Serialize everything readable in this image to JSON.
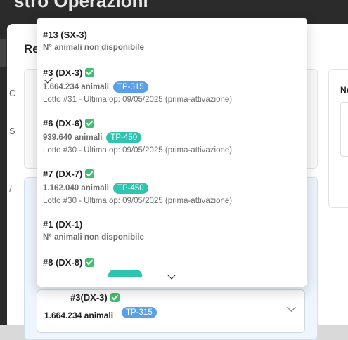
{
  "page": {
    "title": "stro Operazioni"
  },
  "modal": {
    "heading": "Re",
    "right_label": "Nu",
    "left_glyphs": [
      "C",
      "S",
      "/"
    ]
  },
  "dropdown": {
    "options": [
      {
        "title": "#13 (SX-3)",
        "verified": false,
        "count": "N° animali non disponibile",
        "badge": "",
        "badge_color": "",
        "details": ""
      },
      {
        "title": "#3 (DX-3)",
        "verified": true,
        "count": "1.664.234 animali",
        "badge": "TP-315",
        "badge_color": "#5aa0e8",
        "details": "Lotto #31 - Ultima op: 09/05/2025 (prima-attivazione)",
        "selected": true
      },
      {
        "title": "#6 (DX-6)",
        "verified": true,
        "count": "939.640 animali",
        "badge": "TP-450",
        "badge_color": "#2ec4b0",
        "details": "Lotto #30 - Ultima op: 09/05/2025 (prima-attivazione)"
      },
      {
        "title": "#7 (DX-7)",
        "verified": true,
        "count": "1.162.040 animali",
        "badge": "TP-450",
        "badge_color": "#2ec4b0",
        "details": "Lotto #30 - Ultima op: 09/05/2025 (prima-attivazione)"
      },
      {
        "title": "#1 (DX-1)",
        "verified": false,
        "count": "N° animali non disponibile",
        "badge": "",
        "badge_color": "",
        "details": ""
      },
      {
        "title": "#8 (DX-8)",
        "verified": true,
        "count": "",
        "badge": "",
        "badge_color": "#2ec4b0",
        "details": ""
      }
    ]
  },
  "select": {
    "title": "#3(DX-3)",
    "verified": true,
    "count": "1.664.234 animali",
    "badge": "TP-315",
    "badge_color": "#5aa0e8"
  },
  "icons": {
    "check": "check-square-icon",
    "selected": "checkmark-icon",
    "scroll_down": "chevron-down-icon",
    "select_toggle": "chevron-down-icon"
  }
}
